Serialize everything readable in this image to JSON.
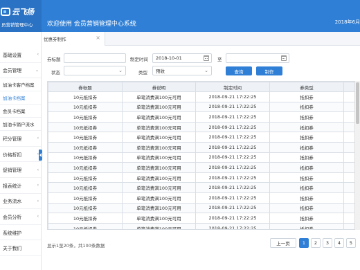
{
  "header": {
    "logo_brand": "云飞扬",
    "logo_sub": "员营销管理中心",
    "title": "欢迎使用  会员营销管理中心系统",
    "date": "2018年6月"
  },
  "tab": {
    "label": "优惠券制作",
    "close": "×"
  },
  "sidebar": {
    "items": [
      {
        "label": "基础设置",
        "type": "group",
        "chevron": "‹"
      },
      {
        "label": "会员管理",
        "type": "group",
        "chevron": "⌄"
      },
      {
        "label": "加油卡客户档案",
        "type": "sub"
      },
      {
        "label": "加油卡档案",
        "type": "sub",
        "active": true
      },
      {
        "label": "会员卡档案",
        "type": "sub"
      },
      {
        "label": "加油卡销户流水",
        "type": "sub"
      },
      {
        "label": "积分管理",
        "type": "group",
        "chevron": "‹"
      },
      {
        "label": "价格折扣",
        "type": "group",
        "chevron": "‹"
      },
      {
        "label": "促销管理",
        "type": "group",
        "chevron": "‹"
      },
      {
        "label": "报表统计",
        "type": "group",
        "chevron": "‹"
      },
      {
        "label": "业务流水",
        "type": "group",
        "chevron": "‹"
      },
      {
        "label": "会员分析",
        "type": "group",
        "chevron": "‹"
      },
      {
        "label": "系统维护",
        "type": "group",
        "chevron": ""
      },
      {
        "label": "关于我们",
        "type": "group",
        "chevron": ""
      }
    ]
  },
  "filters": {
    "title_label": "券标题",
    "title_value": "",
    "time_label": "制定时间",
    "time_value": "2018-10-01",
    "to_label": "至",
    "to_value": "",
    "status_label": "状态",
    "status_value": "",
    "type_label": "类型",
    "type_value": "预收",
    "search_button": "查询",
    "make_button": "制作"
  },
  "table": {
    "columns": [
      "券标题",
      "券说明",
      "制定时间",
      "券类型"
    ],
    "rows": [
      [
        "10元抵扣券",
        "单笔消费满100元可用",
        "2018-09-21 17:22:25",
        "抵扣券"
      ],
      [
        "10元抵扣券",
        "单笔消费满100元可用",
        "2018-09-21 17:22:25",
        "抵扣券"
      ],
      [
        "10元抵扣券",
        "单笔消费满100元可用",
        "2018-09-21 17:22:25",
        "抵扣券"
      ],
      [
        "10元抵扣券",
        "单笔消费满100元可用",
        "2018-09-21 17:22:25",
        "抵扣券"
      ],
      [
        "10元抵扣券",
        "单笔消费满100元可用",
        "2018-09-21 17:22:25",
        "抵扣券"
      ],
      [
        "10元抵扣券",
        "单笔消费满100元可用",
        "2018-09-21 17:22:25",
        "抵扣券"
      ],
      [
        "10元抵扣券",
        "单笔消费满100元可用",
        "2018-09-21 17:22:25",
        "抵扣券"
      ],
      [
        "10元抵扣券",
        "单笔消费满100元可用",
        "2018-09-21 17:22:25",
        "抵扣券"
      ],
      [
        "10元抵扣券",
        "单笔消费满100元可用",
        "2018-09-21 17:22:25",
        "抵扣券"
      ],
      [
        "10元抵扣券",
        "单笔消费满100元可用",
        "2018-09-21 17:22:25",
        "抵扣券"
      ],
      [
        "10元抵扣券",
        "单笔消费满100元可用",
        "2018-09-21 17:22:25",
        "抵扣券"
      ],
      [
        "10元抵扣券",
        "单笔消费满100元可用",
        "2018-09-21 17:22:25",
        "抵扣券"
      ],
      [
        "10元抵扣券",
        "单笔消费满100元可用",
        "2018-09-21 17:22:25",
        "抵扣券"
      ],
      [
        "10元抵扣券",
        "单笔消费满100元可用",
        "2018-09-21 17:22:25",
        "抵扣券"
      ]
    ]
  },
  "footer": {
    "summary": "显示1至20条，共100条数据",
    "prev": "上一页",
    "pages": [
      "1",
      "2",
      "3",
      "4",
      "5"
    ],
    "active_page": "1"
  },
  "colors": {
    "primary": "#2f7fd6",
    "header": "#2f7fd6"
  }
}
